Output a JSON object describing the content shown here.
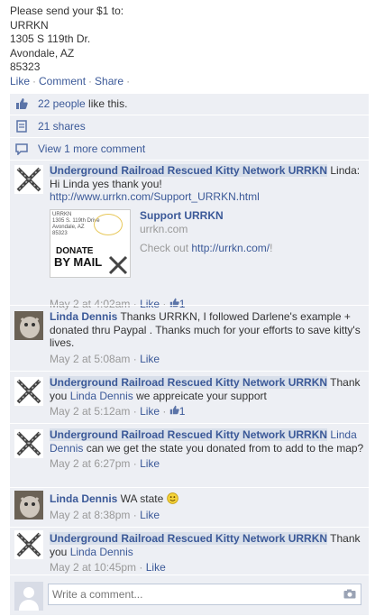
{
  "post": {
    "lines": [
      "Please send your $1 to:",
      "URRKN",
      "1305 S 119th Dr.",
      "Avondale, AZ",
      "85323"
    ],
    "actions": {
      "like": "Like",
      "comment": "Comment",
      "share": "Share"
    }
  },
  "ufi": {
    "likes": "22 people like this.",
    "likes_link": "22 people",
    "likes_rest": " like this.",
    "shares": "21 shares",
    "more_comments": "View 1 more comment"
  },
  "comments": [
    {
      "author": "Underground Railroad Rescued Kitty Network URRKN",
      "text": " Linda: Hi Linda yes thank you!",
      "link": "http://www.urrkn.com/Support_URRKN.html",
      "attachment": {
        "title": "Support URRKN",
        "url": "urrkn.com",
        "desc_prefix": "Check out ",
        "desc_link": "http://urrkn.com/",
        "desc_suffix": "!",
        "thumb_lines": [
          "URRKN",
          "1305 S. 119th Drive",
          "Avondale, AZ",
          "85323"
        ],
        "thumb_big1": "DONATE",
        "thumb_big2": "BY MAIL"
      },
      "time": "May 2 at 4:02am",
      "like": "Like",
      "like_count": "1"
    },
    {
      "author": "Linda Dennis",
      "text": " Thanks URRKN, I followed Darlene's example + donated thru Paypal . Thanks much for your efforts to save kitty's lives.",
      "time": "May 2 at 5:08am",
      "like": "Like"
    },
    {
      "author": "Underground Railroad Rescued Kitty Network URRKN",
      "text_pre": " Thank you ",
      "mention": "Linda Dennis",
      "text_post": " we appreicate your support",
      "time": "May 2 at 5:12am",
      "like": "Like",
      "like_count": "1"
    },
    {
      "author": "Underground Railroad Rescued Kitty Network URRKN",
      "text_pre": " ",
      "mention": "Linda Dennis",
      "text_post": " can we get the state you donated from to add to the map?",
      "time": "May 2 at 6:27pm",
      "like": "Like"
    },
    {
      "author": "Linda Dennis",
      "text": " WA state ",
      "time": "May 2 at 8:38pm",
      "like": "Like"
    },
    {
      "author": "Underground Railroad Rescued Kitty Network URRKN",
      "text_pre": " Thank you ",
      "mention": "Linda Dennis",
      "text_post": "",
      "time": "May 2 at 10:45pm",
      "like": "Like"
    }
  ],
  "write": {
    "placeholder": "Write a comment..."
  },
  "colors": {
    "link": "#3b5998",
    "ufi_bg": "#edeff4",
    "meta": "#999999"
  }
}
